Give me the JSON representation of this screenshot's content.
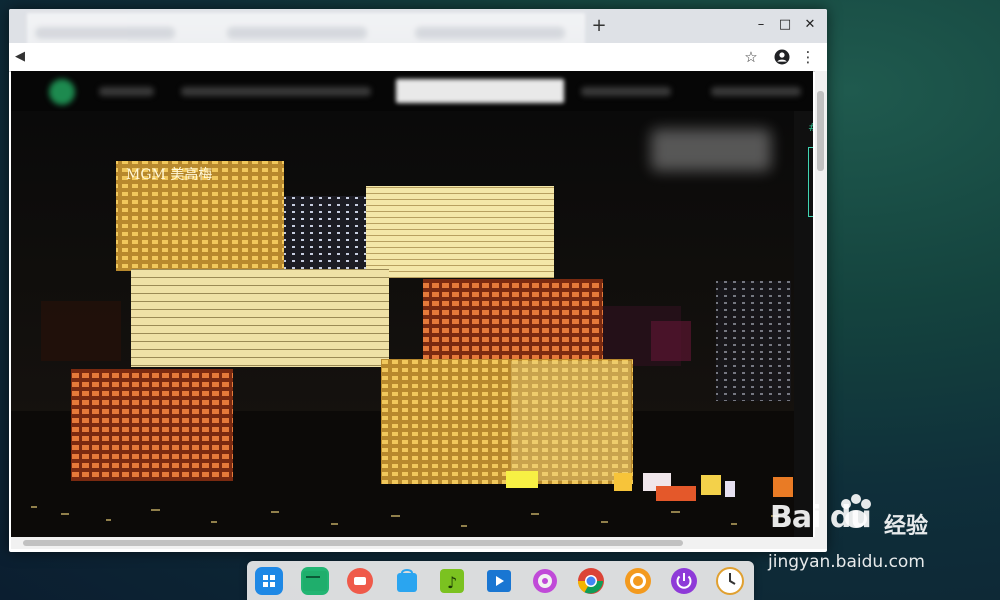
{
  "browser": {
    "new_tab_label": "+",
    "window_controls": {
      "minimize": "–",
      "maximize": "□",
      "close": "✕"
    },
    "toolbar_icons": [
      "back-arrow-icon",
      "star-icon",
      "account-icon",
      "menu-icon"
    ]
  },
  "page": {
    "sidebar_tag": "#",
    "sign_text": "MGM 美高梅"
  },
  "dock": {
    "apps": [
      "launcher-icon",
      "terminal-icon",
      "screen-recorder-icon",
      "app-store-icon",
      "music-icon",
      "video-player-icon",
      "settings-icon",
      "chrome-icon",
      "browser-icon",
      "power-icon",
      "clock-icon"
    ]
  },
  "watermark": {
    "brand": "Bai du",
    "cn": "经验",
    "url": "jingyan.baidu.com"
  },
  "colors": {
    "accent": "#2fbf8f",
    "video_bg": "#050505"
  }
}
